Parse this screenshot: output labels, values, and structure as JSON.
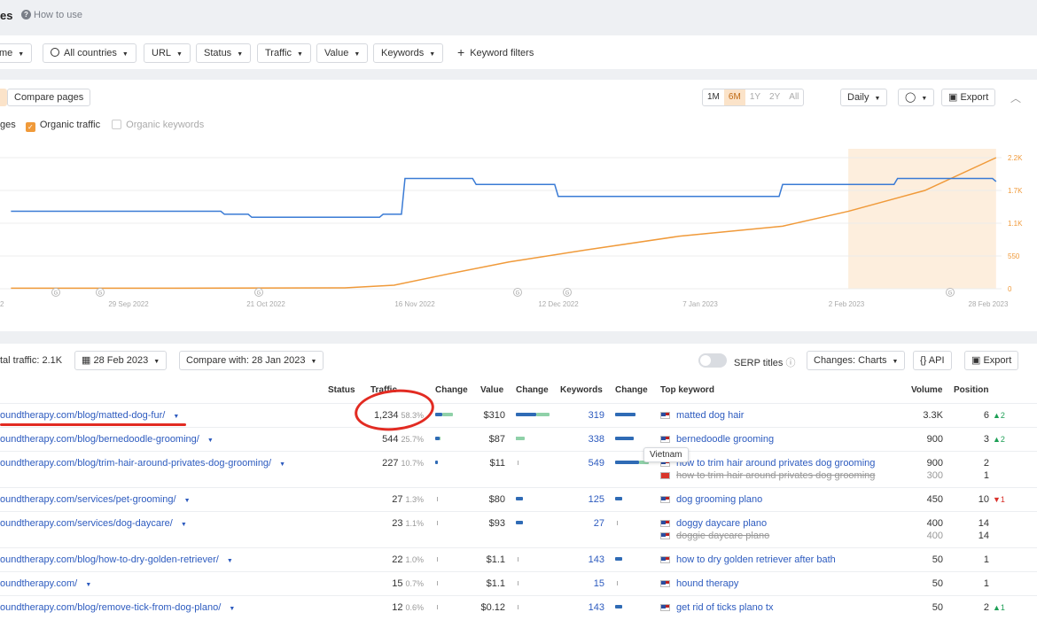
{
  "header": {
    "title": "es",
    "help": "How to use"
  },
  "filters": {
    "items": [
      "me",
      "All countries",
      "URL",
      "Status",
      "Traffic",
      "Value",
      "Keywords"
    ],
    "keyword_filters": "Keyword filters"
  },
  "chart_panel": {
    "compare": "Compare pages",
    "ranges": [
      "1M",
      "6M",
      "1Y",
      "2Y",
      "All"
    ],
    "active_range": "6M",
    "interval": "Daily",
    "export": "Export",
    "legend": {
      "pages": "ges",
      "organic_traffic": "Organic traffic",
      "organic_keywords": "Organic keywords"
    }
  },
  "chart_data": {
    "type": "line",
    "x_ticks": [
      "2",
      "29 Sep 2022",
      "21 Oct 2022",
      "16 Nov 2022",
      "12 Dec 2022",
      "7 Jan 2023",
      "2 Feb 2023",
      "28 Feb 2023"
    ],
    "y_right_ticks": [
      "2.2K",
      "1.7K",
      "1.1K",
      "550",
      "0"
    ],
    "ylim_right": [
      0,
      2200
    ],
    "series": [
      {
        "name": "Organic traffic",
        "color": "#f09a3a",
        "x": [
          "2022-09-01",
          "2022-10-01",
          "2022-11-01",
          "2022-11-10",
          "2022-11-20",
          "2022-12-01",
          "2022-12-15",
          "2023-01-01",
          "2023-01-20",
          "2023-02-01",
          "2023-02-15",
          "2023-02-28"
        ],
        "values": [
          10,
          10,
          15,
          60,
          250,
          450,
          650,
          880,
          1050,
          1300,
          1650,
          2200
        ]
      },
      {
        "name": "Pages",
        "color": "#3a7bd5",
        "x": [
          "2022-09-01",
          "2022-10-10",
          "2022-10-15",
          "2022-11-08",
          "2022-11-12",
          "2022-11-25",
          "2022-12-10",
          "2023-01-05",
          "2023-01-20",
          "2023-02-10",
          "2023-02-28"
        ],
        "values": [
          1300,
          1250,
          1200,
          1250,
          1850,
          1750,
          1550,
          1550,
          1750,
          1850,
          1800
        ]
      }
    ],
    "markers": [
      "G",
      "G",
      "G",
      "G",
      "G",
      "G",
      "G",
      "G"
    ],
    "highlight": [
      "2023-02-01",
      "2023-02-28"
    ]
  },
  "table_panel": {
    "total_traffic": "tal traffic: 2.1K",
    "date": "28 Feb 2023",
    "compare_with": "Compare with: 28 Jan 2023",
    "serp_titles": "SERP titles",
    "changes": "Changes: Charts",
    "api": "API",
    "export": "Export",
    "headers": {
      "status": "Status",
      "traffic": "Traffic",
      "change": "Change",
      "value": "Value",
      "keywords": "Keywords",
      "top_keyword": "Top keyword",
      "volume": "Volume",
      "position": "Position"
    },
    "tooltip": "Vietnam",
    "rows": [
      {
        "url": "oundtherapy.com/blog/matted-dog-fur/",
        "traffic": "1,234",
        "pct": "58.3%",
        "value": "$310",
        "keywords": "319",
        "kw": [
          "matted dog hair"
        ],
        "vol": [
          "3.3K"
        ],
        "pos": [
          "6"
        ],
        "pos_change": "2"
      },
      {
        "url": "oundtherapy.com/blog/bernedoodle-grooming/",
        "traffic": "544",
        "pct": "25.7%",
        "value": "$87",
        "keywords": "338",
        "kw": [
          "bernedoodle grooming"
        ],
        "vol": [
          "900"
        ],
        "pos": [
          "3"
        ],
        "pos_change": "2"
      },
      {
        "url": "oundtherapy.com/blog/trim-hair-around-privates-dog-grooming/",
        "traffic": "227",
        "pct": "10.7%",
        "value": "$11",
        "keywords": "549",
        "kw": [
          "how to trim hair around privates dog grooming",
          "how to trim hair around privates dog grooming"
        ],
        "vol": [
          "900",
          "300"
        ],
        "pos": [
          "2",
          "1"
        ],
        "pos_change": ""
      },
      {
        "url": "oundtherapy.com/services/pet-grooming/",
        "traffic": "27",
        "pct": "1.3%",
        "value": "$80",
        "keywords": "125",
        "kw": [
          "dog grooming plano"
        ],
        "vol": [
          "450"
        ],
        "pos": [
          "10"
        ],
        "pos_change": "1"
      },
      {
        "url": "oundtherapy.com/services/dog-daycare/",
        "traffic": "23",
        "pct": "1.1%",
        "value": "$93",
        "keywords": "27",
        "kw": [
          "doggy daycare plano",
          "doggie daycare plano"
        ],
        "vol": [
          "400",
          "400"
        ],
        "pos": [
          "14",
          "14"
        ],
        "pos_change": ""
      },
      {
        "url": "oundtherapy.com/blog/how-to-dry-golden-retriever/",
        "traffic": "22",
        "pct": "1.0%",
        "value": "$1.1",
        "keywords": "143",
        "kw": [
          "how to dry golden retriever after bath"
        ],
        "vol": [
          "50"
        ],
        "pos": [
          "1"
        ],
        "pos_change": ""
      },
      {
        "url": "oundtherapy.com/",
        "traffic": "15",
        "pct": "0.7%",
        "value": "$1.1",
        "keywords": "15",
        "kw": [
          "hound therapy"
        ],
        "vol": [
          "50"
        ],
        "pos": [
          "1"
        ],
        "pos_change": ""
      },
      {
        "url": "oundtherapy.com/blog/remove-tick-from-dog-plano/",
        "traffic": "12",
        "pct": "0.6%",
        "value": "$0.12",
        "keywords": "143",
        "kw": [
          "get rid of ticks plano tx"
        ],
        "vol": [
          "50"
        ],
        "pos": [
          "2"
        ],
        "pos_change": "1"
      }
    ]
  }
}
